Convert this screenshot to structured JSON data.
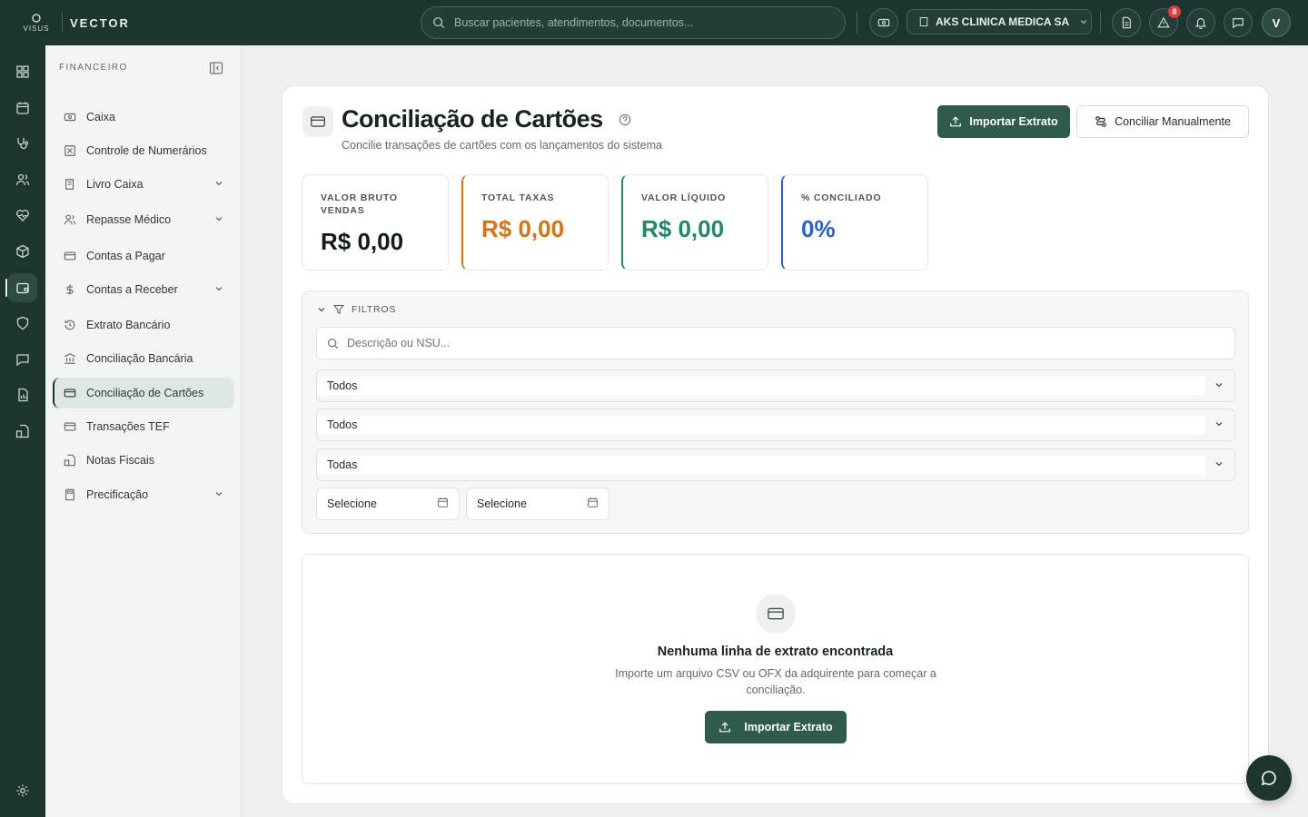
{
  "app": {
    "brand_logo": "VISUS",
    "brand_name": "VECTOR"
  },
  "topbar": {
    "search_placeholder": "Buscar pacientes, atendimentos, documentos...",
    "company": "AKS CLINICA MEDICA SA",
    "alerts_count": "8",
    "avatar_initial": "V"
  },
  "sidebar": {
    "section": "FINANCEIRO",
    "items": [
      {
        "label": "Caixa"
      },
      {
        "label": "Controle de Numerários"
      },
      {
        "label": "Livro Caixa"
      },
      {
        "label": "Repasse Médico"
      },
      {
        "label": "Contas a Pagar"
      },
      {
        "label": "Contas a Receber"
      },
      {
        "label": "Extrato Bancário"
      },
      {
        "label": "Conciliação Bancária"
      },
      {
        "label": "Conciliação de Cartões"
      },
      {
        "label": "Transações TEF"
      },
      {
        "label": "Notas Fiscais"
      },
      {
        "label": "Precificação"
      }
    ]
  },
  "page": {
    "title": "Conciliação de Cartões",
    "subtitle": "Concilie transações de cartões com os lançamentos do sistema",
    "import_button": "Importar Extrato",
    "manual_button": "Conciliar Manualmente"
  },
  "stats": [
    {
      "label": "VALOR BRUTO VENDAS",
      "value": "R$ 0,00",
      "color": "#111c1a"
    },
    {
      "label": "TOTAL TAXAS",
      "value": "R$ 0,00",
      "color": "#d9730d"
    },
    {
      "label": "VALOR LÍQUIDO",
      "value": "R$ 0,00",
      "color": "#1f8a64"
    },
    {
      "label": "% CONCILIADO",
      "value": "0%",
      "color": "#2563d6"
    }
  ],
  "filters": {
    "title": "FILTROS",
    "search_placeholder": "Descrição ou NSU...",
    "select1": "Todos",
    "select2": "Todos",
    "select3": "Todas",
    "date_from": "Selecione",
    "date_to": "Selecione"
  },
  "empty": {
    "title": "Nenhuma linha de extrato encontrada",
    "text": "Importe um arquivo CSV ou OFX da adquirente para começar a conciliação.",
    "button": "Importar Extrato"
  },
  "colors": {
    "primary": "#2f5a4e",
    "dark": "#1d3530",
    "taxas": "#d9730d",
    "liquido": "#1f8a64",
    "conciliado": "#2563d6"
  }
}
